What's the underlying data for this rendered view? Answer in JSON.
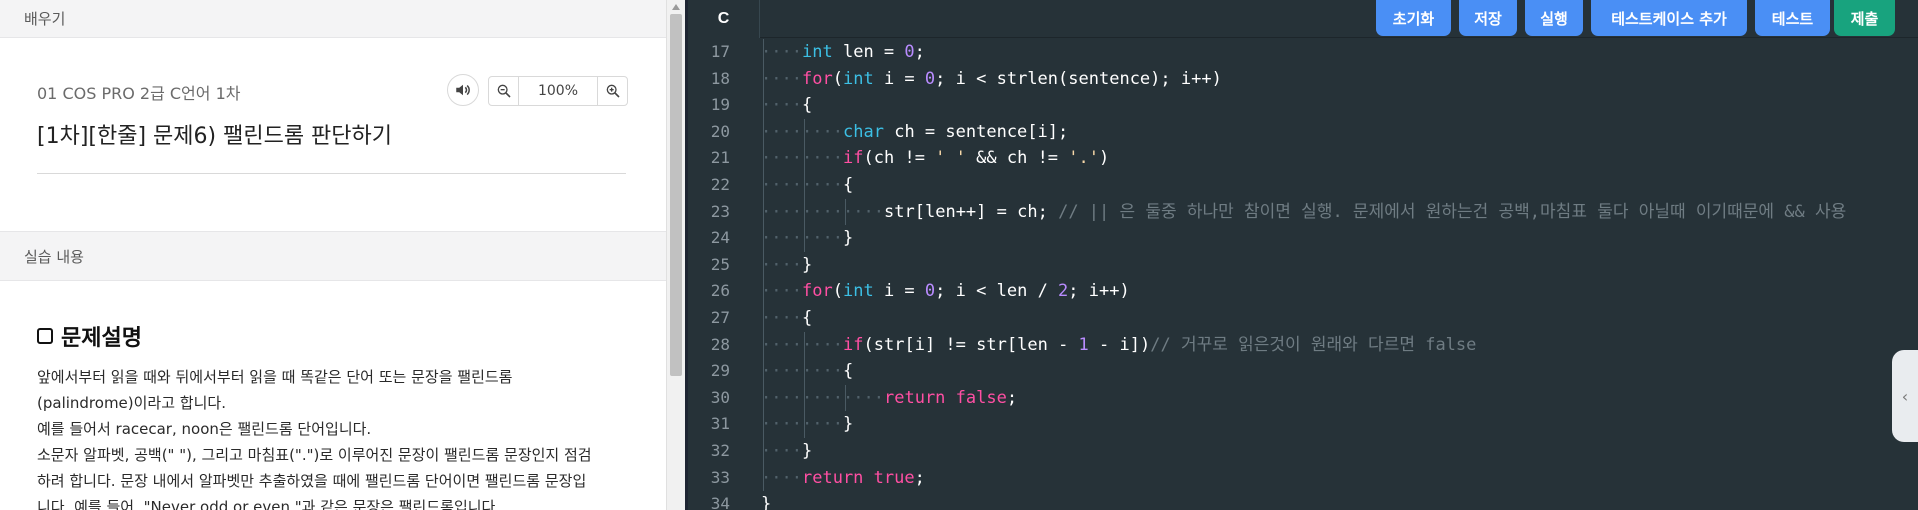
{
  "left_panel": {
    "learn_header": "배우기",
    "course_subtitle": "01 COS PRO 2급 C언어 1차",
    "problem_title": "[1차][한줄] 문제6) 팰린드롬 판단하기",
    "zoom_value": "100%",
    "practice_header": "실습 내용",
    "description_heading": "문제설명",
    "description_lines": [
      "앞에서부터 읽을 때와 뒤에서부터 읽을 때 똑같은 단어 또는 문장을 팰린드롬",
      "(palindrome)이라고 합니다.",
      "예를 들어서 racecar, noon은 팰린드롬 단어입니다.",
      "소문자 알파벳, 공백(\" \"), 그리고 마침표(\".\")로 이루어진 문장이 팰린드롬 문장인지 점검",
      "하려 합니다. 문장 내에서 알파벳만 추출하였을 때에 팰린드롬 단어이면 팰린드롬 문장입",
      "니다. 예를 들어, \"Never odd or even.\"과 같은 문장은 팰린드롬입니다."
    ],
    "icons": {
      "speaker": "speaker-icon",
      "zoom_out": "zoom-out-icon",
      "zoom_in": "zoom-in-icon"
    }
  },
  "editor": {
    "language": "C",
    "toolbar": {
      "reset": "초기화",
      "save": "저장",
      "run": "실행",
      "add_testcase": "테스트케이스 추가",
      "test": "테스트",
      "submit": "제출"
    },
    "colors": {
      "background": "#263238",
      "primary_button": "#4a8ff5",
      "submit_button": "#18a37e",
      "keyword": "#ff4fa3",
      "type": "#3cbfe4",
      "number": "#b98cff",
      "comment": "#6f7c83"
    },
    "code_lines": [
      {
        "n": "17",
        "text": "    int len = 0;"
      },
      {
        "n": "18",
        "text": "    for(int i = 0; i < strlen(sentence); i++)"
      },
      {
        "n": "19",
        "text": "    {"
      },
      {
        "n": "20",
        "text": "        char ch = sentence[i];"
      },
      {
        "n": "21",
        "text": "        if(ch != ' ' && ch != '.')"
      },
      {
        "n": "22",
        "text": "        {"
      },
      {
        "n": "23",
        "text": "            str[len++] = ch; // || 은 둘중 하나만 참이면 실행. 문제에서 원하는건 공백,마침표 둘다 아닐때 이기때문에 && 사용"
      },
      {
        "n": "24",
        "text": "        }"
      },
      {
        "n": "25",
        "text": "    }"
      },
      {
        "n": "26",
        "text": "    for(int i = 0; i < len / 2; i++)"
      },
      {
        "n": "27",
        "text": "    {"
      },
      {
        "n": "28",
        "text": "        if(str[i] != str[len - 1 - i])// 거꾸로 읽은것이 원래와 다르면 false"
      },
      {
        "n": "29",
        "text": "        {"
      },
      {
        "n": "30",
        "text": "            return false;"
      },
      {
        "n": "31",
        "text": "        }"
      },
      {
        "n": "32",
        "text": "    }"
      },
      {
        "n": "33",
        "text": "    return true;"
      },
      {
        "n": "34",
        "text": "}"
      }
    ]
  }
}
